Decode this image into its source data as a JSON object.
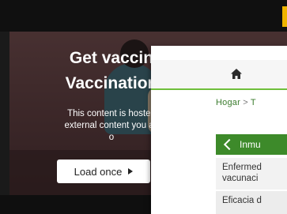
{
  "video": {
    "title_line1": "Get vaccin",
    "title_line2": "Vaccination",
    "desc_line1": "This content is hosted",
    "desc_line2": "external content you ac",
    "desc_line3": "o",
    "load_button_label": "Load once"
  },
  "panel": {
    "home_icon": "home-icon",
    "breadcrumb": {
      "home": "Hogar",
      "separator": ">",
      "next": "T"
    },
    "menu": {
      "header_label": "Inmu",
      "items": [
        {
          "line1": "Enfermed",
          "line2": "vacunaci"
        },
        {
          "line1": "Eficacia d"
        }
      ]
    }
  },
  "colors": {
    "accent_green": "#3d8a2a",
    "header_line": "#6fbf3b",
    "accent_yellow": "#f0b400"
  }
}
